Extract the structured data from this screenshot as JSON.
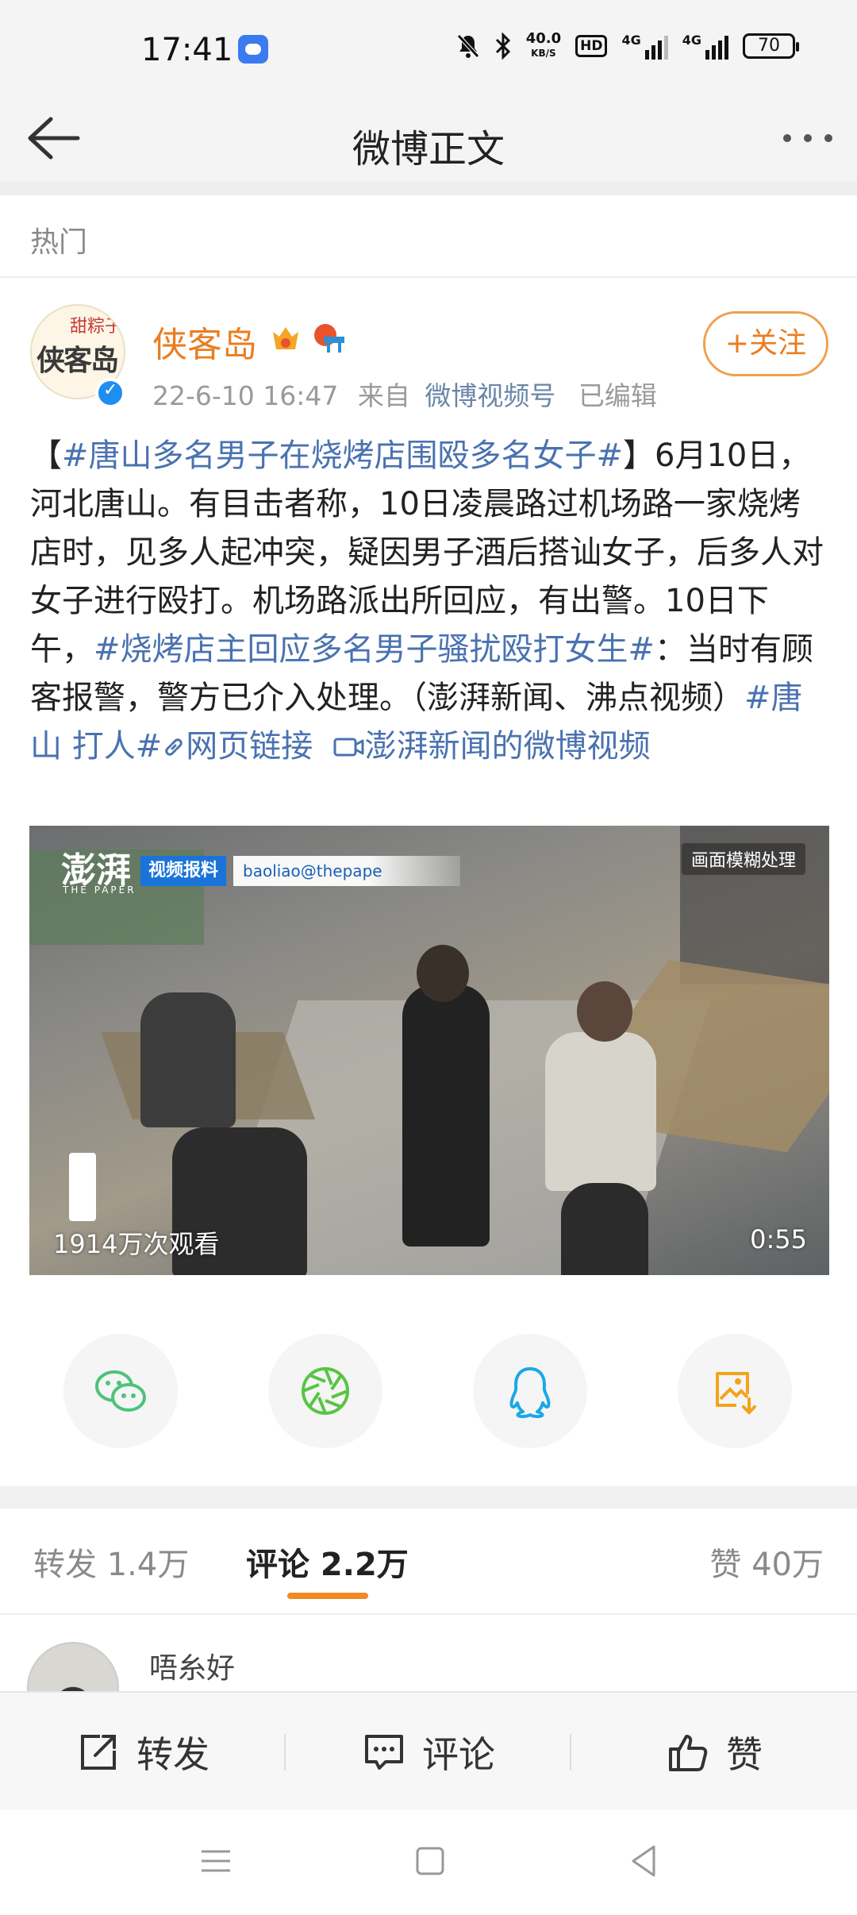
{
  "status_bar": {
    "time": "17:41",
    "speed": "40.0",
    "speed_unit": "KB/S",
    "hd_label": "HD",
    "net1": "4G",
    "net2": "4G",
    "battery": "70"
  },
  "header": {
    "title": "微博正文",
    "back_icon": "arrow-left-icon",
    "more_icon": "more-horizontal-icon"
  },
  "section_label": "热门",
  "post": {
    "author": {
      "avatar_tag": "甜粽子",
      "avatar_text": "侠客岛",
      "name": "侠客岛",
      "verified": true
    },
    "meta": {
      "time": "22-6-10 16:47",
      "from_prefix": "来自",
      "source": "微博视频号",
      "edited": "已编辑"
    },
    "follow_label": "+关注",
    "content": {
      "p1": "【",
      "tag1": "#唐山多名男子在烧烤店围殴多名女子#",
      "p2": "】6月10日，河北唐山。有目击者称，10日凌晨路过机场路一家烧烤店时，见多人起冲突，疑因男子酒后搭讪女子，后多人对女子进行殴打。机场路派出所回应，有出警。10日下午，",
      "tag2": "#烧烤店主回应多名男子骚扰殴打女生#",
      "p3": "：当时有顾客报警，警方已介入处理。（澎湃新闻、沸点视频）",
      "tag3": "#唐山 打人#",
      "link_label": "网页链接",
      "video_link_label": "澎湃新闻的微博视频"
    },
    "video": {
      "logo": "澎湃",
      "logo_sub": "THE PAPER",
      "report_label": "视频报料",
      "email": "baoliao@thepape",
      "blur_note": "画面模糊处理",
      "views": "1914万次观看",
      "duration": "0:55"
    },
    "share_targets": [
      {
        "name": "wechat-icon",
        "color": "#4cc37a"
      },
      {
        "name": "moments-icon",
        "color": "#58c445"
      },
      {
        "name": "qq-icon",
        "color": "#1aa8e8"
      },
      {
        "name": "save-image-icon",
        "color": "#f3a31b"
      }
    ]
  },
  "tabs": {
    "repost": "转发 1.4万",
    "comment": "评论 2.2万",
    "like": "赞 40万",
    "active_color": "#f08a24"
  },
  "comment_preview": {
    "name": "唔糸好"
  },
  "action_bar": {
    "repost": "转发",
    "comment": "评论",
    "like": "赞"
  }
}
